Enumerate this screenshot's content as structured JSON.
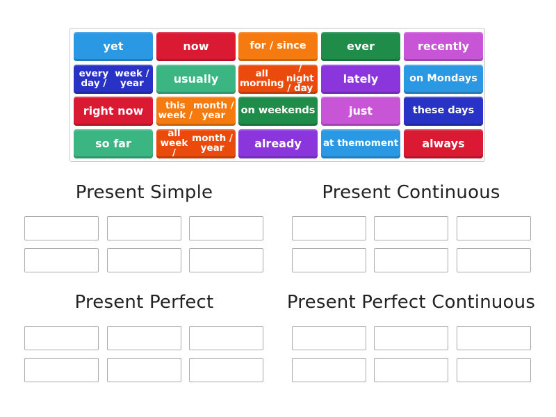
{
  "activity": {
    "type": "group-sort",
    "tiles": [
      {
        "label": "yet",
        "color": "#2b98e3"
      },
      {
        "label": "now",
        "color": "#d91a32"
      },
      {
        "label": "for / since",
        "color": "#f57b10"
      },
      {
        "label": "ever",
        "color": "#1f8c4a"
      },
      {
        "label": "recently",
        "color": "#c755d6"
      },
      {
        "label": "every day / week / year",
        "color": "#2832c4"
      },
      {
        "label": "usually",
        "color": "#3bb582"
      },
      {
        "label": "all morning / night / day",
        "color": "#ea4a0c"
      },
      {
        "label": "lately",
        "color": "#8a36dc"
      },
      {
        "label": "on Mondays",
        "color": "#2b98e3"
      },
      {
        "label": "right now",
        "color": "#d91a32"
      },
      {
        "label": "this week / month / year",
        "color": "#f57b10"
      },
      {
        "label": "on weekends",
        "color": "#1f8c4a"
      },
      {
        "label": "just",
        "color": "#c755d6"
      },
      {
        "label": "these days",
        "color": "#2832c4"
      },
      {
        "label": "so far",
        "color": "#3bb582"
      },
      {
        "label": "all week / month / year",
        "color": "#ea4a0c"
      },
      {
        "label": "already",
        "color": "#8a36dc"
      },
      {
        "label": "at the moment",
        "color": "#2b98e3"
      },
      {
        "label": "always",
        "color": "#d91a32"
      }
    ],
    "groups": [
      {
        "title": "Present Simple",
        "slots": 6
      },
      {
        "title": "Present Continuous",
        "slots": 6
      },
      {
        "title": "Present Perfect",
        "slots": 6
      },
      {
        "title": "Present Perfect Continuous",
        "slots": 6
      }
    ]
  }
}
